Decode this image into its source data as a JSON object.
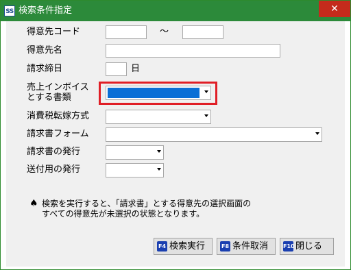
{
  "window": {
    "app_icon_text": "SS",
    "title": "検索条件指定",
    "close_glyph": "✕"
  },
  "form": {
    "customer_code": {
      "label": "得意先コード",
      "from_value": "",
      "to_value": "",
      "range_separator": "～"
    },
    "customer_name": {
      "label": "得意先名",
      "value": ""
    },
    "closing_day": {
      "label": "請求締日",
      "value": "",
      "unit": "日"
    },
    "sales_invoice_type": {
      "label_line1": "売上インボイス",
      "label_line2": "とする書類",
      "selected_value": ""
    },
    "tax_method": {
      "label": "消費税転嫁方式",
      "selected_value": ""
    },
    "invoice_form": {
      "label": "請求書フォーム",
      "selected_value": ""
    },
    "invoice_issue": {
      "label": "請求書の発行",
      "selected_value": ""
    },
    "delivery_issue": {
      "label": "送付用の発行",
      "selected_value": ""
    }
  },
  "note": {
    "icon": "spade-icon",
    "line1": "検索を実行すると、「請求書」とする得意先の選択画面の",
    "line2": "すべての得意先が未選択の状態となります。"
  },
  "buttons": {
    "search": {
      "key": "F4",
      "label": "検索実行"
    },
    "clear": {
      "key": "F8",
      "label": "条件取消"
    },
    "close": {
      "key": "F10",
      "label": "閉じる"
    }
  },
  "colors": {
    "titlebar": "#2c8a3a",
    "close_button": "#c42b1c",
    "highlight_border": "#e01e26",
    "selected_fill": "#0a6fd6",
    "function_key": "#1a3fb0"
  }
}
